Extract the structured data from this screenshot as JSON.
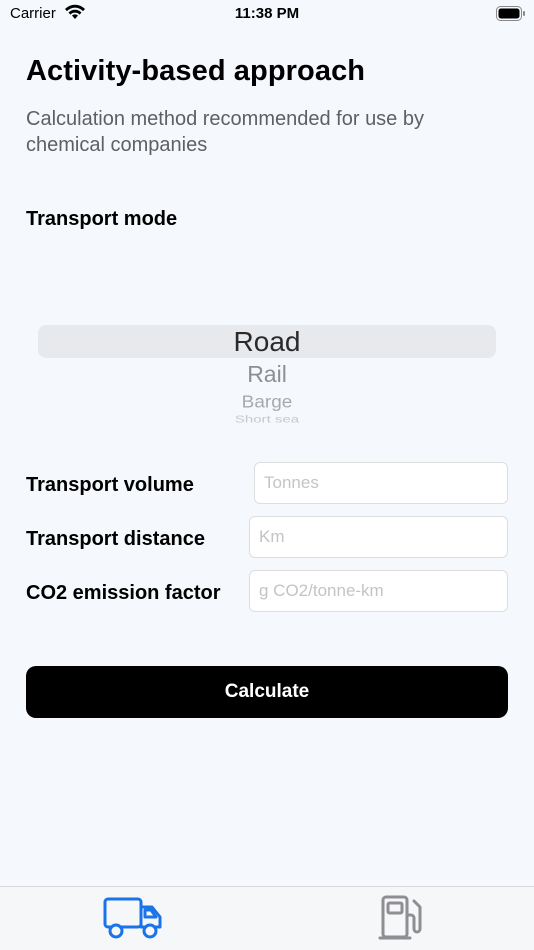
{
  "status_bar": {
    "carrier": "Carrier",
    "time": "11:38 PM",
    "wifi_icon": "wifi-icon",
    "battery_icon": "battery-icon"
  },
  "header": {
    "title": "Activity-based approach",
    "subtitle": "Calculation method recommended for use by chemical companies"
  },
  "transport_mode": {
    "label": "Transport mode",
    "options": [
      "Road",
      "Rail",
      "Barge",
      "Short sea"
    ],
    "selected": "Road"
  },
  "form": {
    "volume": {
      "label": "Transport volume",
      "placeholder": "Tonnes",
      "value": ""
    },
    "distance": {
      "label": "Transport distance",
      "placeholder": "Km",
      "value": ""
    },
    "co2": {
      "label": "CO2 emission factor",
      "placeholder": "g CO2/tonne-km",
      "value": ""
    }
  },
  "actions": {
    "calculate_label": "Calculate"
  },
  "tab_bar": {
    "tabs": [
      {
        "icon": "truck-icon",
        "active": true
      },
      {
        "icon": "fuel-pump-icon",
        "active": false
      }
    ]
  },
  "colors": {
    "background": "#f5f8fc",
    "accent": "#1a73e8",
    "inactive_tab": "#8e8e93",
    "button": "#000000"
  }
}
